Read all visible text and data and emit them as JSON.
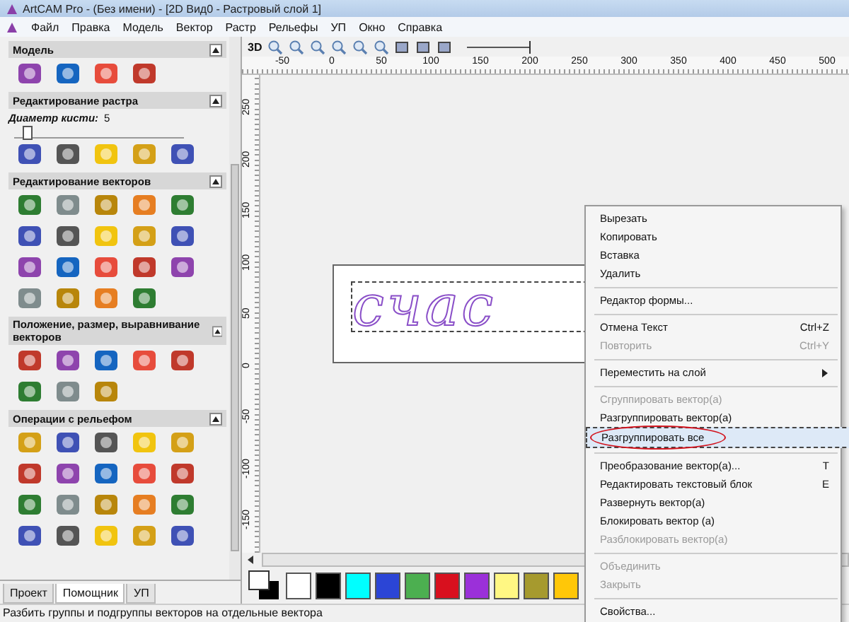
{
  "window": {
    "title": "ArtCAM Pro - (Без имени) - [2D Вид0 - Растровый слой 1]"
  },
  "menu_bar": [
    "Файл",
    "Правка",
    "Модель",
    "Вектор",
    "Растр",
    "Рельефы",
    "УП",
    "Окно",
    "Справка"
  ],
  "left_panel": {
    "sections": [
      {
        "title": "Модель",
        "expanded": true
      },
      {
        "title": "Редактирование растра",
        "expanded": true,
        "brush": {
          "label": "Диаметр кисти:",
          "value": "5",
          "level": 0.05
        }
      },
      {
        "title": "Редактирование векторов",
        "expanded": true
      },
      {
        "title": "Положение, размер, выравнивание векторов",
        "expanded": true
      },
      {
        "title": "Операции с рельефом",
        "expanded": true
      }
    ],
    "tabs": [
      {
        "label": "Проект",
        "selected": false
      },
      {
        "label": "Помощник",
        "selected": true
      },
      {
        "label": "УП",
        "selected": false
      }
    ]
  },
  "view_toolbar": {
    "mode_label": "3D",
    "zoom_slider": {
      "level": 1
    }
  },
  "rulers": {
    "horizontal": [
      "-50",
      "0",
      "50",
      "100",
      "150",
      "200",
      "250",
      "300",
      "350",
      "400",
      "450",
      "500"
    ],
    "vertical": [
      "250",
      "200",
      "150",
      "100",
      "50",
      "0",
      "-50",
      "-100",
      "-150"
    ]
  },
  "canvas": {
    "vector_text": "счас"
  },
  "palette": [
    {
      "color": "#ffffff"
    },
    {
      "color": "#000000"
    },
    {
      "color": "#00ffff"
    },
    {
      "color": "#2b45d6"
    },
    {
      "color": "#4caf50"
    },
    {
      "color": "#d8101e"
    },
    {
      "color": "#9b30d9"
    },
    {
      "color": "#fff783"
    },
    {
      "color": "#a69a2e"
    },
    {
      "color": "#ffc708"
    }
  ],
  "context_menu": [
    {
      "kind": "item",
      "label": "Вырезать",
      "disabled": false,
      "selected": false,
      "submenu": false,
      "circled": false
    },
    {
      "kind": "item",
      "label": "Копировать",
      "disabled": false,
      "selected": false,
      "submenu": false,
      "circled": false
    },
    {
      "kind": "item",
      "label": "Вставка",
      "disabled": false,
      "selected": false,
      "submenu": false,
      "circled": false
    },
    {
      "kind": "item",
      "label": "Удалить",
      "disabled": false,
      "selected": false,
      "submenu": false,
      "circled": false
    },
    {
      "kind": "separator"
    },
    {
      "kind": "item",
      "label": "Редактор формы...",
      "disabled": false,
      "selected": false,
      "submenu": false,
      "circled": false
    },
    {
      "kind": "separator"
    },
    {
      "kind": "item",
      "label": "Отмена Текст",
      "shortcut": "Ctrl+Z",
      "disabled": false,
      "selected": false,
      "submenu": false,
      "circled": false
    },
    {
      "kind": "item",
      "label": "Повторить",
      "shortcut": "Ctrl+Y",
      "disabled": true,
      "selected": false,
      "submenu": false,
      "circled": false
    },
    {
      "kind": "separator"
    },
    {
      "kind": "item",
      "label": "Переместить на слой",
      "disabled": false,
      "selected": false,
      "submenu": true,
      "circled": false
    },
    {
      "kind": "separator"
    },
    {
      "kind": "item",
      "label": "Сгруппировать вектор(а)",
      "disabled": true,
      "selected": false,
      "submenu": false,
      "circled": false
    },
    {
      "kind": "item",
      "label": "Разгруппировать вектор(а)",
      "disabled": false,
      "selected": false,
      "submenu": false,
      "circled": false
    },
    {
      "kind": "item",
      "label": "Разгруппировать все",
      "disabled": false,
      "selected": true,
      "submenu": false,
      "circled": true
    },
    {
      "kind": "separator"
    },
    {
      "kind": "item",
      "label": "Преобразование вектор(а)...",
      "shortcut": "T",
      "disabled": false,
      "selected": false,
      "submenu": false,
      "circled": false
    },
    {
      "kind": "item",
      "label": "Редактировать текстовый блок",
      "shortcut": "E",
      "disabled": false,
      "selected": false,
      "submenu": false,
      "circled": false
    },
    {
      "kind": "item",
      "label": "Развернуть вектор(а)",
      "disabled": false,
      "selected": false,
      "submenu": false,
      "circled": false
    },
    {
      "kind": "item",
      "label": "Блокировать вектор (а)",
      "disabled": false,
      "selected": false,
      "submenu": false,
      "circled": false
    },
    {
      "kind": "item",
      "label": "Разблокировать вектор(а)",
      "disabled": true,
      "selected": false,
      "submenu": false,
      "circled": false
    },
    {
      "kind": "separator"
    },
    {
      "kind": "item",
      "label": "Объединить",
      "disabled": true,
      "selected": false,
      "submenu": false,
      "circled": false
    },
    {
      "kind": "item",
      "label": "Закрыть",
      "disabled": true,
      "selected": false,
      "submenu": false,
      "circled": false
    },
    {
      "kind": "separator"
    },
    {
      "kind": "item",
      "label": "Свойства...",
      "disabled": false,
      "selected": false,
      "submenu": false,
      "circled": false
    }
  ],
  "status_bar": "Разбить группы и подгруппы векторов на отдельные вектора"
}
